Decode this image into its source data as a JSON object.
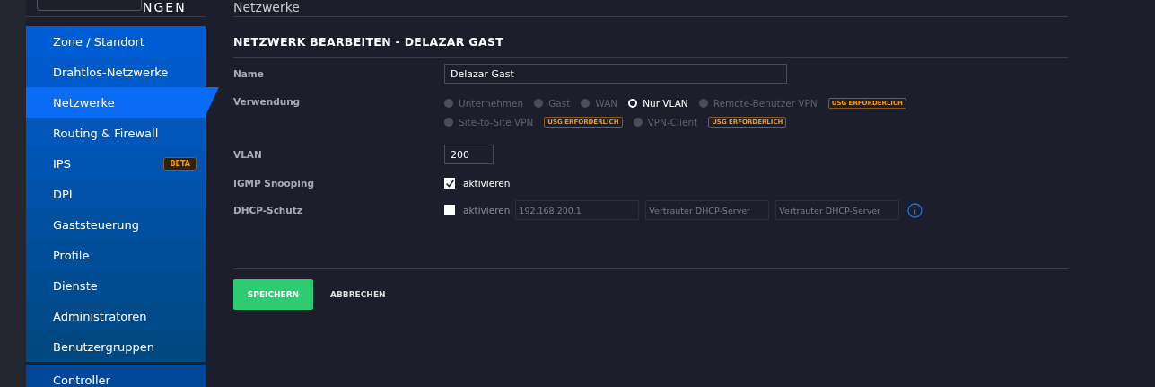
{
  "header": {
    "title": "NGEN"
  },
  "sidebar": {
    "items": [
      {
        "label": "Zone / Standort",
        "selected": false
      },
      {
        "label": "Drahtlos-Netzwerke",
        "selected": false
      },
      {
        "label": "Netzwerke",
        "selected": true
      },
      {
        "label": "Routing & Firewall",
        "selected": false
      },
      {
        "label": "IPS",
        "selected": false,
        "badge": "BETA"
      },
      {
        "label": "DPI",
        "selected": false
      },
      {
        "label": "Gaststeuerung",
        "selected": false
      },
      {
        "label": "Profile",
        "selected": false
      },
      {
        "label": "Dienste",
        "selected": false
      },
      {
        "label": "Administratoren",
        "selected": false
      },
      {
        "label": "Benutzergruppen",
        "selected": false
      }
    ],
    "footer_items": [
      {
        "label": "Controller",
        "selected": false
      }
    ]
  },
  "page_title": "Netzwerke",
  "form": {
    "title": "NETZWERK BEARBEITEN - DELAZAR GAST",
    "name": {
      "label": "Name",
      "value": "Delazar Gast"
    },
    "usage": {
      "label": "Verwendung",
      "option_rows": [
        [
          {
            "label": "Unternehmen",
            "selected": false
          },
          {
            "label": "Gast",
            "selected": false
          },
          {
            "label": "WAN",
            "selected": false
          },
          {
            "label": "Nur VLAN",
            "selected": true
          },
          {
            "label": "Remote-Benutzer VPN",
            "selected": false,
            "badge": "USG ERFORDERLICH"
          }
        ],
        [
          {
            "label": "Site-to-Site VPN",
            "selected": false,
            "badge": "USG ERFORDERLICH"
          },
          {
            "label": "VPN-Client",
            "selected": false,
            "badge": "USG ERFORDERLICH"
          }
        ]
      ]
    },
    "vlan": {
      "label": "VLAN",
      "value": "200"
    },
    "igmp": {
      "label": "IGMP Snooping",
      "checkbox_label": "aktivieren",
      "checked": true
    },
    "dhcp": {
      "label": "DHCP-Schutz",
      "checkbox_label": "aktivieren",
      "checked": false,
      "fields": [
        {
          "placeholder": "192.168.200.1"
        },
        {
          "placeholder": "Vertrauter DHCP-Server"
        },
        {
          "placeholder": "Vertrauter DHCP-Server"
        }
      ]
    },
    "buttons": {
      "save": "SPEICHERN",
      "cancel": "ABBRECHEN"
    }
  }
}
